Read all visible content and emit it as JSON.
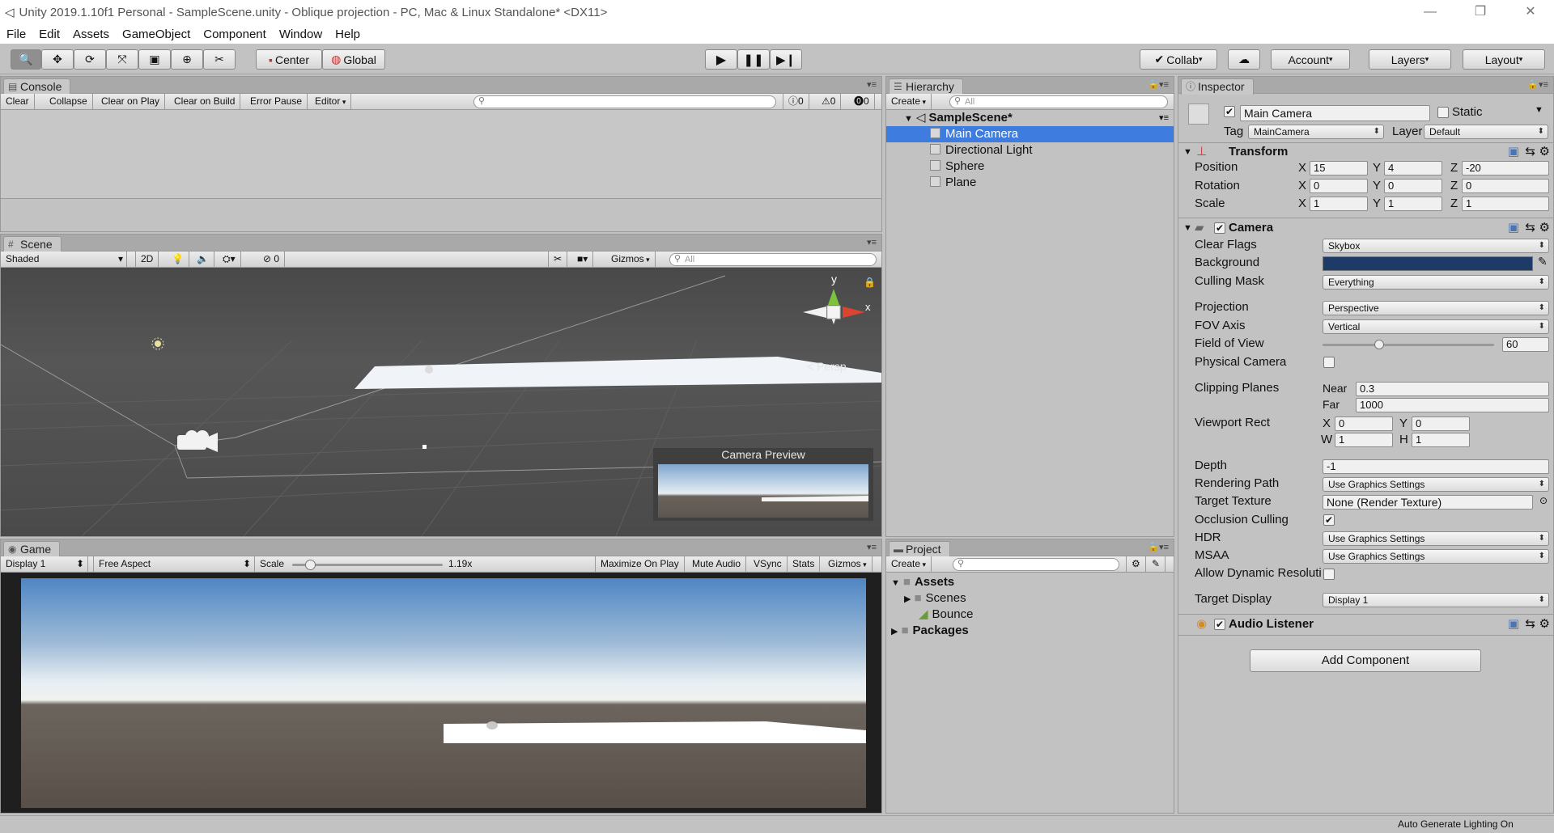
{
  "window": {
    "title": "Unity 2019.1.10f1 Personal - SampleScene.unity - Oblique projection - PC, Mac & Linux Standalone* <DX11>",
    "minimize": "—",
    "maximize": "❐",
    "close": "✕"
  },
  "menu": [
    "File",
    "Edit",
    "Assets",
    "GameObject",
    "Component",
    "Window",
    "Help"
  ],
  "toolbar": {
    "tools": [
      "hand-tool-icon",
      "move-tool-icon",
      "rotate-tool-icon",
      "scale-tool-icon",
      "rect-tool-icon",
      "transform-tool-icon",
      "custom-tool-icon"
    ],
    "pivot": "Center",
    "space": "Global",
    "collab": "Collab",
    "account": "Account",
    "layers": "Layers",
    "layout": "Layout"
  },
  "console": {
    "tab": "Console",
    "buttons": [
      "Clear",
      "Collapse",
      "Clear on Play",
      "Clear on Build",
      "Error Pause",
      "Editor"
    ],
    "info_count": "0",
    "warn_count": "0",
    "error_count": "0"
  },
  "scene": {
    "tab": "Scene",
    "shading": "Shaded",
    "mode_2d": "2D",
    "hidden_count": "0",
    "gizmos": "Gizmos",
    "search_placeholder": "All",
    "persp_label": "Persp",
    "axis_y": "y",
    "axis_x": "x",
    "camera_preview": "Camera Preview"
  },
  "game": {
    "tab": "Game",
    "display": "Display 1",
    "aspect": "Free Aspect",
    "scale_label": "Scale",
    "scale_value": "1.19x",
    "scale_fraction": 0.12,
    "buttons": [
      "Maximize On Play",
      "Mute Audio",
      "VSync",
      "Stats",
      "Gizmos"
    ]
  },
  "hierarchy": {
    "tab": "Hierarchy",
    "create": "Create",
    "search_placeholder": "All",
    "scene_name": "SampleScene*",
    "items": [
      "Main Camera",
      "Directional Light",
      "Sphere",
      "Plane"
    ],
    "selected": "Main Camera"
  },
  "project": {
    "tab": "Project",
    "create": "Create",
    "tree": [
      {
        "label": "Assets",
        "bold": true
      },
      {
        "label": "Scenes",
        "bold": false
      },
      {
        "label": "Bounce",
        "bold": false
      },
      {
        "label": "Packages",
        "bold": true
      }
    ]
  },
  "inspector": {
    "tab": "Inspector",
    "object_name": "Main Camera",
    "static_label": "Static",
    "tag_label": "Tag",
    "tag_value": "MainCamera",
    "layer_label": "Layer",
    "layer_value": "Default",
    "transform": {
      "title": "Transform",
      "rows": [
        {
          "label": "Position",
          "x": "15",
          "y": "4",
          "z": "-20"
        },
        {
          "label": "Rotation",
          "x": "0",
          "y": "0",
          "z": "0"
        },
        {
          "label": "Scale",
          "x": "1",
          "y": "1",
          "z": "1"
        }
      ]
    },
    "camera": {
      "title": "Camera",
      "clear_flags_label": "Clear Flags",
      "clear_flags": "Skybox",
      "background_label": "Background",
      "background_color": "#1e3a66",
      "culling_mask_label": "Culling Mask",
      "culling_mask": "Everything",
      "projection_label": "Projection",
      "projection": "Perspective",
      "fov_axis_label": "FOV Axis",
      "fov_axis": "Vertical",
      "fov_label": "Field of View",
      "fov": "60",
      "fov_fraction": 0.33,
      "physical_label": "Physical Camera",
      "clipping_label": "Clipping Planes",
      "near_label": "Near",
      "near": "0.3",
      "far_label": "Far",
      "far": "1000",
      "viewport_label": "Viewport Rect",
      "vx": "0",
      "vy": "0",
      "vw": "1",
      "vh": "1",
      "depth_label": "Depth",
      "depth": "-1",
      "rendering_label": "Rendering Path",
      "rendering": "Use Graphics Settings",
      "target_tex_label": "Target Texture",
      "target_tex": "None (Render Texture)",
      "occlusion_label": "Occlusion Culling",
      "hdr_label": "HDR",
      "hdr": "Use Graphics Settings",
      "msaa_label": "MSAA",
      "msaa": "Use Graphics Settings",
      "dyn_res_label": "Allow Dynamic Resoluti",
      "target_display_label": "Target Display",
      "target_display": "Display 1"
    },
    "audio_listener": "Audio Listener",
    "add_component": "Add Component"
  },
  "status": "Auto Generate Lighting On"
}
